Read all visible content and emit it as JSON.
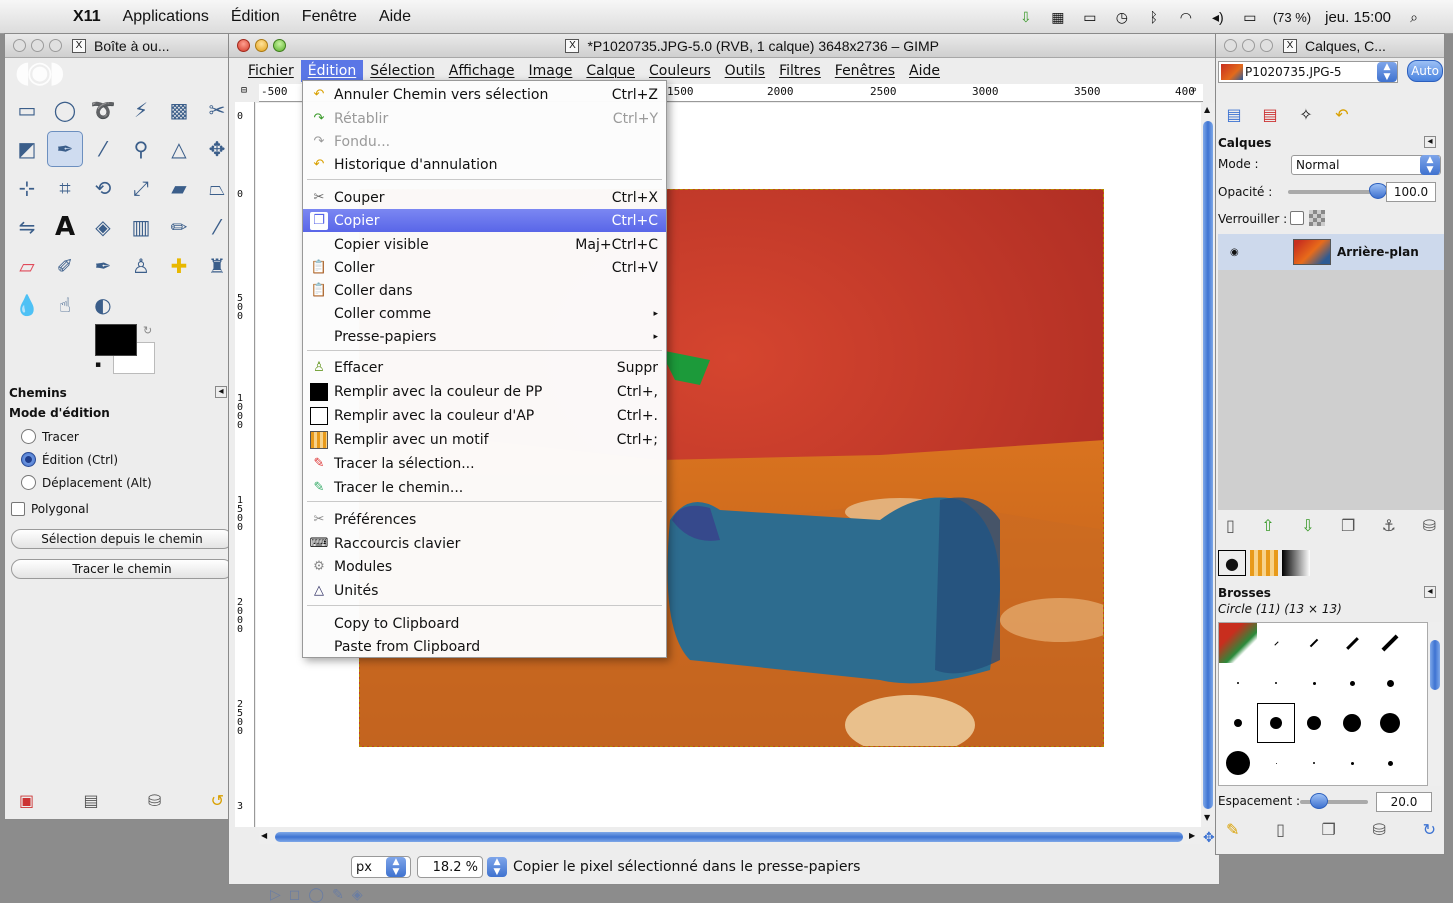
{
  "menubar": {
    "app": "X11",
    "items": [
      "Applications",
      "Édition",
      "Fenêtre",
      "Aide"
    ],
    "battery": "(73 %)",
    "clock": "jeu. 15:00"
  },
  "toolbox": {
    "title": "Boîte à ou...",
    "paths_header": "Chemins",
    "mode_label": "Mode d'édition",
    "modes": [
      "Tracer",
      "Édition (Ctrl)",
      "Déplacement (Alt)"
    ],
    "selected_mode": 1,
    "polygonal_label": "Polygonal",
    "btn_selection": "Sélection depuis le chemin",
    "btn_stroke": "Tracer le chemin",
    "tools": [
      "rect-select-icon",
      "ellipse-select-icon",
      "lasso-icon",
      "fuzzy-select-icon",
      "color-select-icon",
      "scissors-icon",
      "foreground-select-icon",
      "paths-icon",
      "color-picker-icon",
      "zoom-icon",
      "measure-icon",
      "move-icon",
      "align-icon",
      "crop-icon",
      "rotate-icon",
      "scale-icon",
      "shear-icon",
      "perspective-icon",
      "flip-icon",
      "text-icon",
      "bucket-fill-icon",
      "blend-icon",
      "pencil-icon",
      "paintbrush-icon",
      "eraser-icon",
      "airbrush-icon",
      "ink-icon",
      "clone-icon",
      "heal-icon",
      "perspective-clone-icon",
      "blur-icon",
      "smudge-icon",
      "dodge-burn-icon"
    ]
  },
  "main": {
    "title": "*P1020735.JPG-5.0 (RVB, 1 calque) 3648x2736 – GIMP",
    "menus": [
      "Fichier",
      "Édition",
      "Sélection",
      "Affichage",
      "Image",
      "Calque",
      "Couleurs",
      "Outils",
      "Filtres",
      "Fenêtres",
      "Aide"
    ],
    "active_menu": "Édition",
    "ruler_top": [
      "-500",
      "1500",
      "2000",
      "2500",
      "3000",
      "3500",
      "400"
    ],
    "ruler_left": [
      "0",
      "0",
      "500",
      "1000",
      "1500",
      "2000",
      "2500",
      "3"
    ],
    "unit": "px",
    "zoom": "18.2 %",
    "status": "Copier le pixel sélectionné dans le presse-papiers",
    "image_colors": {
      "wall": "#c83a2a",
      "floor": "#d66a1c",
      "clay": "#2f6d8e"
    }
  },
  "edit_menu": {
    "items": [
      {
        "icon": "undo-icon",
        "label": "Annuler Chemin vers sélection",
        "shortcut": "Ctrl+Z",
        "state": "normal"
      },
      {
        "icon": "redo-icon",
        "label": "Rétablir",
        "shortcut": "Ctrl+Y",
        "state": "disabled"
      },
      {
        "icon": "fade-icon",
        "label": "Fondu...",
        "shortcut": "",
        "state": "disabled"
      },
      {
        "icon": "history-icon",
        "label": "Historique d'annulation",
        "shortcut": "",
        "state": "normal"
      },
      {
        "icon": "cut-icon",
        "label": "Couper",
        "shortcut": "Ctrl+X",
        "state": "normal"
      },
      {
        "icon": "copy-icon",
        "label": "Copier",
        "shortcut": "Ctrl+C",
        "state": "highlighted"
      },
      {
        "icon": "",
        "label": "Copier visible",
        "shortcut": "Maj+Ctrl+C",
        "state": "normal"
      },
      {
        "icon": "paste-icon",
        "label": "Coller",
        "shortcut": "Ctrl+V",
        "state": "normal"
      },
      {
        "icon": "paste-into-icon",
        "label": "Coller dans",
        "shortcut": "",
        "state": "normal"
      },
      {
        "icon": "",
        "label": "Coller comme",
        "shortcut": "▸",
        "state": "normal"
      },
      {
        "icon": "",
        "label": "Presse-papiers",
        "shortcut": "▸",
        "state": "normal"
      },
      {
        "icon": "clear-icon",
        "label": "Effacer",
        "shortcut": "Suppr",
        "state": "normal"
      },
      {
        "icon": "fill-fg-icon",
        "label": "Remplir avec la couleur de PP",
        "shortcut": "Ctrl+,",
        "state": "normal"
      },
      {
        "icon": "fill-bg-icon",
        "label": "Remplir avec la couleur d'AP",
        "shortcut": "Ctrl+.",
        "state": "normal"
      },
      {
        "icon": "fill-pattern-icon",
        "label": "Remplir avec un motif",
        "shortcut": "Ctrl+;",
        "state": "normal"
      },
      {
        "icon": "stroke-selection-icon",
        "label": "Tracer la sélection...",
        "shortcut": "",
        "state": "normal"
      },
      {
        "icon": "stroke-path-icon",
        "label": "Tracer le chemin...",
        "shortcut": "",
        "state": "normal"
      },
      {
        "icon": "preferences-icon",
        "label": "Préférences",
        "shortcut": "",
        "state": "normal"
      },
      {
        "icon": "keyboard-icon",
        "label": "Raccourcis clavier",
        "shortcut": "",
        "state": "normal"
      },
      {
        "icon": "modules-icon",
        "label": "Modules",
        "shortcut": "",
        "state": "normal"
      },
      {
        "icon": "units-icon",
        "label": "Unités",
        "shortcut": "",
        "state": "normal"
      },
      {
        "icon": "",
        "label": "Copy to Clipboard",
        "shortcut": "",
        "state": "normal"
      },
      {
        "icon": "",
        "label": "Paste from Clipboard",
        "shortcut": "",
        "state": "normal"
      }
    ]
  },
  "dock": {
    "title": "Calques, C...",
    "image_selector": "P1020735.JPG-5",
    "auto_label": "Auto",
    "layers_header": "Calques",
    "mode_label": "Mode :",
    "mode_value": "Normal",
    "opacity_label": "Opacité :",
    "opacity_value": "100.0",
    "opacity_fraction": 1.0,
    "lock_label": "Verrouiller :",
    "layer_name": "Arrière-plan",
    "brushes_header": "Brosses",
    "brush_name": "Circle (11) (13 × 13)",
    "spacing_label": "Espacement :",
    "spacing_value": "20.0"
  }
}
